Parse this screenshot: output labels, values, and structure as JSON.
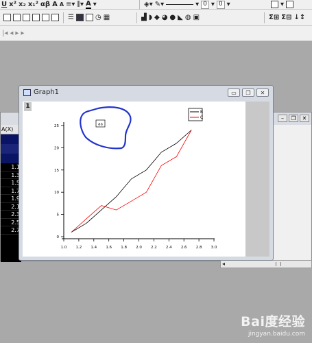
{
  "graph_window": {
    "title": "Graph1",
    "layer_label": "1",
    "annotation_text": "aa",
    "controls": [
      "minimize",
      "restore",
      "close"
    ]
  },
  "worksheet": {
    "column_header": "A(X)",
    "rows": [
      "1.1",
      "1.3",
      "1.5",
      "1.7",
      "1.9",
      "2.1",
      "2.3",
      "2.5",
      "2.7"
    ]
  },
  "chart_data": {
    "type": "line",
    "x": [
      1.1,
      1.3,
      1.5,
      1.7,
      1.9,
      2.1,
      2.3,
      2.5,
      2.7
    ],
    "series": [
      {
        "name": "B",
        "color": "#000000",
        "values": [
          1,
          3,
          6,
          9,
          13,
          15,
          19,
          21,
          24
        ]
      },
      {
        "name": "C",
        "color": "#ff0000",
        "values": [
          1,
          4,
          7,
          6,
          8,
          10,
          16,
          18,
          24
        ]
      }
    ],
    "xlim": [
      1.0,
      3.0
    ],
    "ylim": [
      0,
      25
    ],
    "xticks": [
      "1.0",
      "1.2",
      "1.4",
      "1.6",
      "1.8",
      "2.0",
      "2.2",
      "2.4",
      "2.6",
      "2.8",
      "3.0"
    ],
    "yticks": [
      "0",
      "5",
      "10",
      "15",
      "20",
      "25"
    ],
    "legend_position": "top-right",
    "grid": false
  },
  "toolbar": {
    "icons": [
      "underline-icon",
      "superscript-icon",
      "subscript-icon",
      "supersubscript-icon",
      "greek-icon",
      "font-color-icon",
      "align-icon",
      "fill-icon",
      "line-color-icon"
    ],
    "line_width_value": "0",
    "pattern_value": "0"
  },
  "watermark": {
    "logo": "Bai度经验",
    "url": "jingyan.baidu.com"
  }
}
